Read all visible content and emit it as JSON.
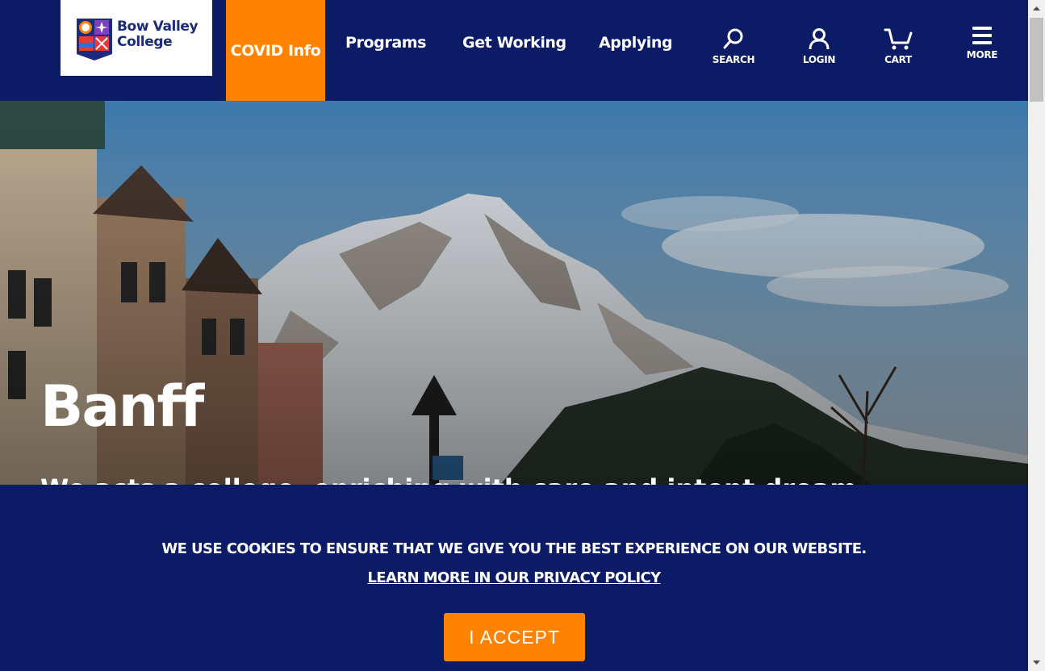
{
  "logo": {
    "line1": "Bow Valley",
    "line2": "College"
  },
  "nav": {
    "covid": "COVID Info",
    "programs": "Programs",
    "get_working": "Get Working",
    "applying": "Applying"
  },
  "utility": {
    "search": {
      "label": "SEARCH",
      "icon": "search-icon"
    },
    "login": {
      "label": "LOGIN",
      "icon": "user-icon"
    },
    "cart": {
      "label": "CART",
      "icon": "cart-icon"
    },
    "more": {
      "label": "MORE",
      "icon": "menu-icon"
    }
  },
  "hero": {
    "title": "Banff",
    "subtitle": "We acts a college, enriching with care and intent dream"
  },
  "cookie": {
    "message": "WE USE COOKIES TO ENSURE THAT WE GIVE YOU THE BEST EXPERIENCE ON OUR WEBSITE.",
    "link": "LEARN MORE IN OUR PRIVACY POLICY",
    "accept": "I ACCEPT"
  },
  "colors": {
    "navy": "#0b1b66",
    "orange": "#ff8300"
  }
}
